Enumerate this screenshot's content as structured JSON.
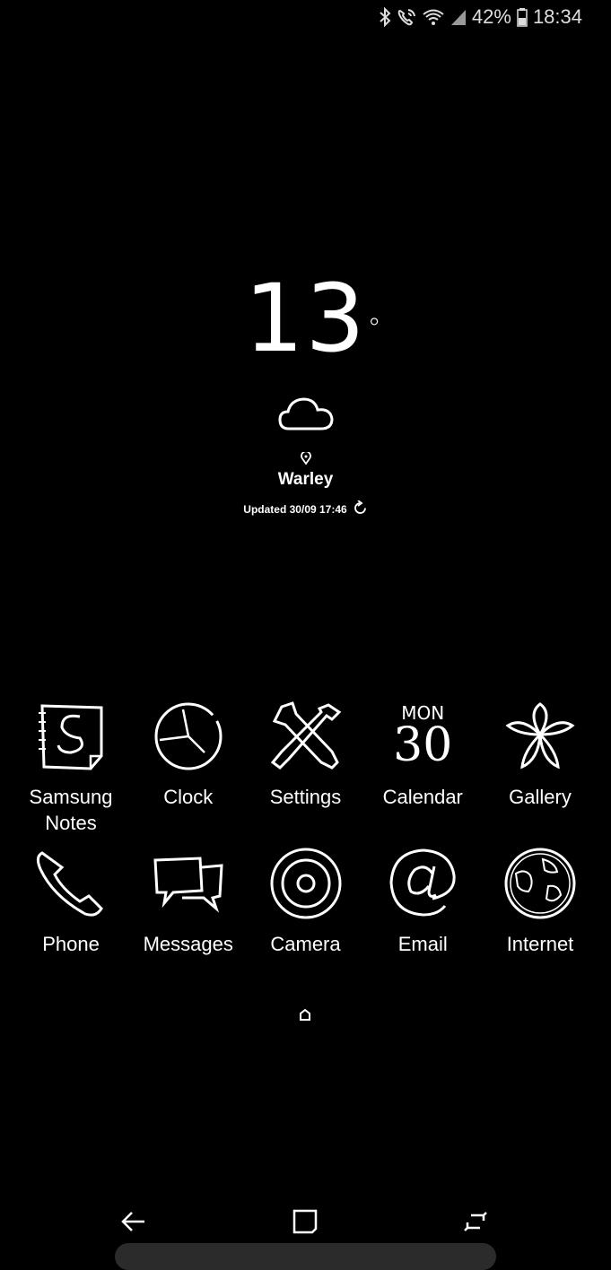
{
  "status": {
    "battery": "42%",
    "time": "18:34",
    "icons": [
      "bluetooth-icon",
      "wifi-calling-icon",
      "wifi-icon",
      "signal-icon",
      "battery-icon"
    ]
  },
  "weather": {
    "temp": "13",
    "deg": "°",
    "location": "Warley",
    "updated": "Updated 30/09 17:46",
    "icon": "cloud-icon"
  },
  "apps": {
    "row1": [
      {
        "label": "Samsung\nNotes",
        "icon": "samsung-notes-icon"
      },
      {
        "label": "Clock",
        "icon": "clock-icon"
      },
      {
        "label": "Settings",
        "icon": "settings-icon"
      },
      {
        "label": "Calendar",
        "icon": "calendar-icon"
      },
      {
        "label": "Gallery",
        "icon": "gallery-icon"
      }
    ],
    "row2": [
      {
        "label": "Phone",
        "icon": "phone-icon"
      },
      {
        "label": "Messages",
        "icon": "messages-icon"
      },
      {
        "label": "Camera",
        "icon": "camera-icon"
      },
      {
        "label": "Email",
        "icon": "email-icon"
      },
      {
        "label": "Internet",
        "icon": "internet-icon"
      }
    ],
    "calendar_day": "MON",
    "calendar_date": "30"
  },
  "nav": {
    "back": "back-icon",
    "home": "home-icon",
    "recents": "recents-icon"
  }
}
